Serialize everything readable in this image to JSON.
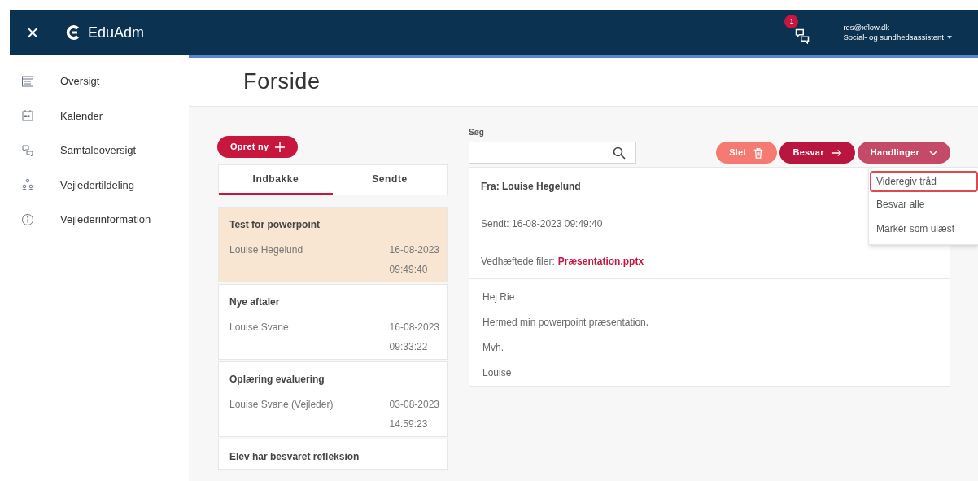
{
  "app": {
    "close_icon": "×",
    "name": "EduAdm"
  },
  "header": {
    "notification_count": "1",
    "email": "res@xflow.dk",
    "role": "Social- og sundhedsassistent"
  },
  "sidebar": {
    "items": [
      {
        "label": "Oversigt"
      },
      {
        "label": "Kalender"
      },
      {
        "label": "Samtaleoversigt"
      },
      {
        "label": "Vejledertildeling"
      },
      {
        "label": "Vejlederinformation"
      }
    ]
  },
  "page_title": "Forside",
  "new_button": "Opret ny",
  "tabs": [
    {
      "label": "Indbakke",
      "selected": true
    },
    {
      "label": "Sendte",
      "selected": false
    }
  ],
  "messages": [
    {
      "subject": "Test for powerpoint",
      "sender": "Louise Hegelund",
      "date": "16-08-2023",
      "time": "09:49:40",
      "selected": true
    },
    {
      "subject": "Nye aftaler",
      "sender": "Louise Svane",
      "date": "16-08-2023",
      "time": "09:33:22",
      "selected": false
    },
    {
      "subject": "Oplæring evaluering",
      "sender": "Louise Svane (Vejleder)",
      "date": "03-08-2023",
      "time": "14:59:23",
      "selected": false
    },
    {
      "subject": "Elev har besvaret refleksion",
      "selected": false
    }
  ],
  "search": {
    "label": "Søg"
  },
  "actions": [
    {
      "label": "Slet",
      "kind": "delete"
    },
    {
      "label": "Besvar",
      "kind": "reply"
    },
    {
      "label": "Handlinger",
      "kind": "menu"
    }
  ],
  "menu": [
    {
      "label": "Videregiv tråd",
      "selected": true
    },
    {
      "label": "Besvar alle",
      "selected": false
    },
    {
      "label": "Markér som ulæst",
      "selected": false
    }
  ],
  "detail": {
    "from": "Fra: Louise Hegelund",
    "sent": "Sendt: 16-08-2023 09:49:40",
    "attachments_label": "Vedhæftede filer:",
    "attachment": "Præsentation.pptx",
    "body": [
      "Hej Rie",
      "Hermed min powerpoint præsentation.",
      "Mvh.",
      "Louise"
    ]
  }
}
